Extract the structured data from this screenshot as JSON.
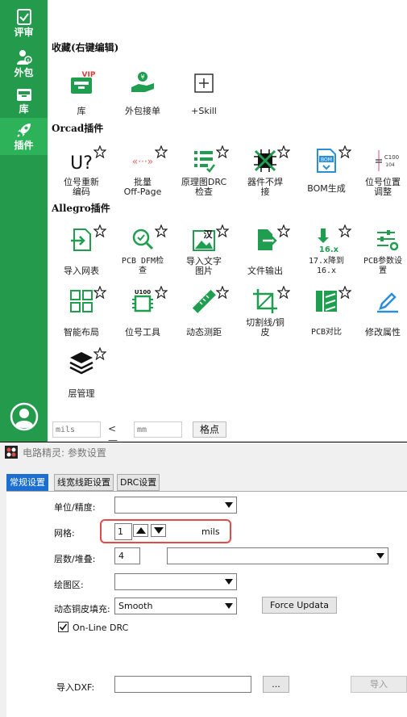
{
  "sidebar": {
    "items": [
      {
        "label": "评审",
        "icon": "review-clipboard-icon"
      },
      {
        "label": "外包",
        "icon": "outsource-user-icon"
      },
      {
        "label": "库",
        "icon": "library-box-icon"
      },
      {
        "label": "插件",
        "icon": "rocket-plugin-icon"
      }
    ],
    "avatar_icon": "user-avatar-icon"
  },
  "sections": {
    "favorites": "收藏(右键编辑)",
    "orcad": "Orcad插件",
    "allegro": "Allegro插件"
  },
  "favorites": [
    {
      "label": "库",
      "icon": "vip-library-icon"
    },
    {
      "label": "外包接单",
      "icon": "hand-coin-icon"
    },
    {
      "label": "+Skill",
      "icon": "plus-square-icon"
    }
  ],
  "orcad_tools": [
    {
      "label": "位号重新\n编码",
      "icon": "u-question-icon"
    },
    {
      "label": "批量\nOff-Page",
      "icon": "offpage-arrows-icon",
      "badge": "«···»"
    },
    {
      "label": "原理图DRC\n检查",
      "icon": "drc-list-icon"
    },
    {
      "label": "器件不焊\n接",
      "icon": "no-solder-chip-icon"
    },
    {
      "label": "BOM生成",
      "icon": "bom-file-icon",
      "badge": "BOM"
    },
    {
      "label": "位号位置\n调整",
      "icon": "capacitor-label-icon",
      "badge_top": "C100",
      "badge_bottom": "104"
    }
  ],
  "allegro_tools": [
    {
      "label": "导入网表",
      "icon": "import-netlist-icon"
    },
    {
      "label": "PCB DFM检\n查",
      "icon": "dfm-magnifier-icon"
    },
    {
      "label": "导入文字\n图片",
      "icon": "import-text-image-icon",
      "badge": "汉"
    },
    {
      "label": "文件输出",
      "icon": "file-export-icon"
    },
    {
      "label": "17.x降到\n16.x",
      "icon": "downgrade-arrow-icon",
      "badge": "16.x"
    },
    {
      "label": "PCB参数设\n置",
      "icon": "sliders-gear-icon"
    },
    {
      "label": "智能布局",
      "icon": "layout-grid-icon"
    },
    {
      "label": "位号工具",
      "icon": "refdes-chip-icon",
      "badge": "U100"
    },
    {
      "label": "动态测距",
      "icon": "ruler-icon"
    },
    {
      "label": "切割线/铜\n皮",
      "icon": "crop-cut-icon"
    },
    {
      "label": "PCB对比",
      "icon": "compare-bars-icon"
    },
    {
      "label": "修改属性",
      "icon": "edit-pen-icon"
    },
    {
      "label": "层管理",
      "icon": "layers-stack-icon"
    }
  ],
  "grid_bar": {
    "input1_placeholder": "mils",
    "separator": "<—>",
    "input2_placeholder": "mm",
    "button": "格点"
  },
  "dialog": {
    "title": "电路精灵: 参数设置",
    "tabs": [
      "常规设置",
      "线宽线距设置",
      "DRC设置"
    ],
    "active_tab": 0,
    "labels": {
      "unit": "单位/精度:",
      "grid": "网格:",
      "layer": "层数/堆叠:",
      "draw_area": "绘图区:",
      "dynamic_fill": "动态铜皮填充:",
      "import_dxf": "导入DXF:"
    },
    "grid_value": "1",
    "grid_unit": "mils",
    "layer_value": "4",
    "dynamic_fill_value": "Smooth",
    "force_button": "Force Updata",
    "online_drc": "On-Line DRC",
    "online_drc_checked": true,
    "browse_button": "...",
    "import_button": "导入"
  },
  "colors": {
    "sidebar": "#249a4c",
    "sidebar_active": "#2db25a",
    "icon_green": "#1f9e4f",
    "icon_blue": "#2a8fd8",
    "tab_active": "#1c6fd0",
    "highlight": "#e34b4b"
  }
}
